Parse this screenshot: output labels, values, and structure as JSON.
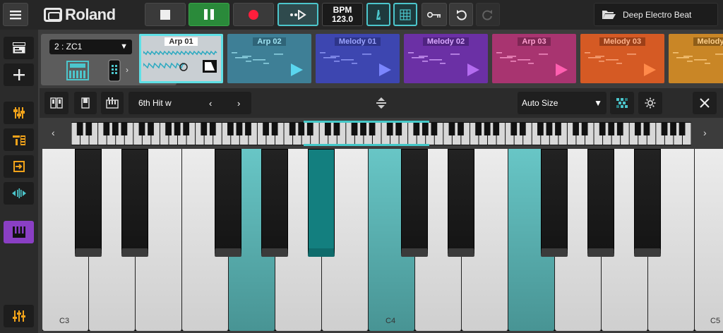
{
  "topbar": {
    "brand": "Roland",
    "bpm_label": "BPM",
    "bpm_value": "123.0",
    "project_name": "Deep Electro Beat"
  },
  "track": {
    "name": "2 : ZC1"
  },
  "clips": [
    {
      "name": "Arp 01",
      "bg": "#c9cfd3",
      "title_bg": "#ffffff",
      "title_color": "#2a2a2a",
      "selected": true
    },
    {
      "name": "Arp 02",
      "bg": "#3e7f96",
      "title_bg": "#2f6478",
      "title_color": "#9fe3f2",
      "play_color": "#5ad6ef"
    },
    {
      "name": "Melody 01",
      "bg": "#3d46b0",
      "title_bg": "#2e358a",
      "title_color": "#9aa3ff",
      "play_color": "#7b86ff"
    },
    {
      "name": "Melody 02",
      "bg": "#6b30a5",
      "title_bg": "#4f2380",
      "title_color": "#d9a8ff",
      "play_color": "#b46cf0"
    },
    {
      "name": "Arp 03",
      "bg": "#a83470",
      "title_bg": "#7e2654",
      "title_color": "#ff9fd0",
      "play_color": "#ff5fb0"
    },
    {
      "name": "Melody 03",
      "bg": "#d55a24",
      "title_bg": "#9c3f18",
      "title_color": "#ffb28a",
      "play_color": "#ff8a4a"
    },
    {
      "name": "Melody",
      "bg": "#c98626",
      "title_bg": "#8e5d18",
      "title_color": "#ffd08a",
      "play_color": "#ffb042"
    }
  ],
  "controls": {
    "patch_name": "6th Hit w",
    "size_mode": "Auto Size"
  },
  "keyboard": {
    "labels": [
      "C3",
      "C4",
      "C5"
    ],
    "accent": "#5fc4c4"
  }
}
